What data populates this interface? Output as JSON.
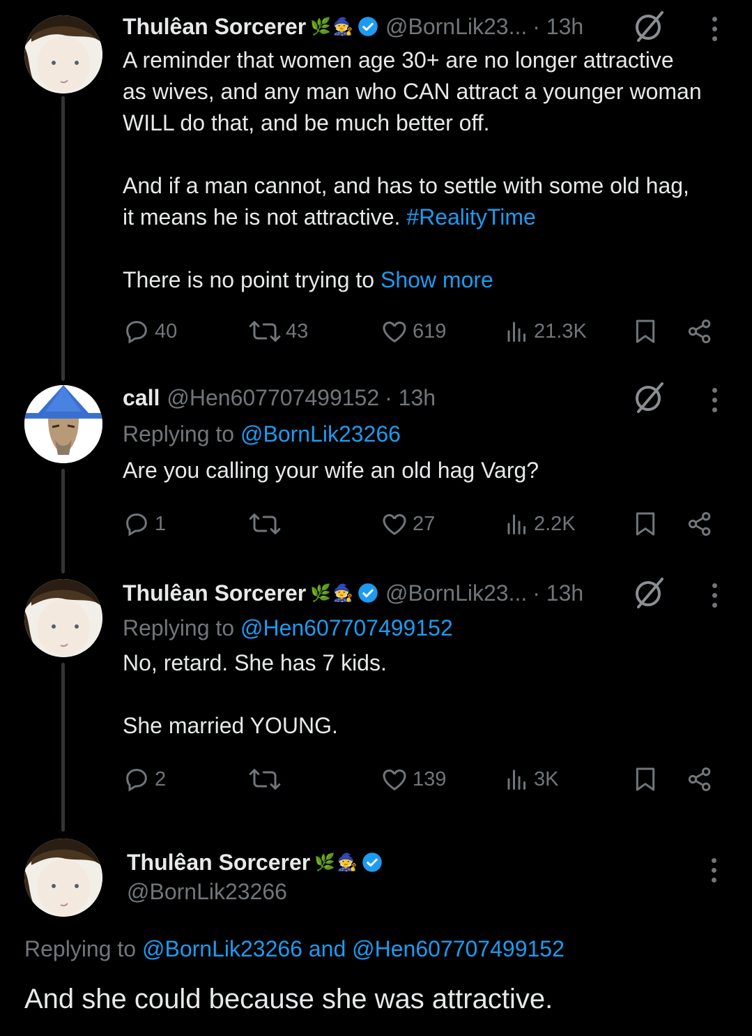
{
  "tweets": [
    {
      "name": "Thulêan Sorcerer",
      "handle": "@BornLik23...",
      "time": "· 13h",
      "body_lines": [
        "A reminder that women age 30+ are no longer attractive",
        "as wives, and any man who CAN attract a younger woman",
        "WILL do that, and be much better off."
      ],
      "body_para2_line1": "And if a man cannot, and has to settle with some old hag,",
      "body_para2_line2_text": "it means he is not attractive. ",
      "hashtag": "#RealityTime",
      "body_para3_text": "There is no point trying to ",
      "show_more": "Show more",
      "stats": {
        "replies": "40",
        "reposts": "43",
        "likes": "619",
        "views": "21.3K"
      }
    },
    {
      "name": "call",
      "handle": "@Hen607707499152",
      "time": "· 13h",
      "replying_prefix": "Replying to ",
      "replying_to": "@BornLik23266",
      "body": "Are you calling your wife an old hag Varg?",
      "stats": {
        "replies": "1",
        "reposts": "",
        "likes": "27",
        "views": "2.2K"
      }
    },
    {
      "name": "Thulêan Sorcerer",
      "handle": "@BornLik23...",
      "time": "· 13h",
      "replying_prefix": "Replying to ",
      "replying_to": "@Hen607707499152",
      "body_line1": "No, retard. She has 7 kids.",
      "body_line2": "She married YOUNG.",
      "stats": {
        "replies": "2",
        "reposts": "",
        "likes": "139",
        "views": "3K"
      }
    }
  ],
  "focused": {
    "name": "Thulêan Sorcerer",
    "handle": "@BornLik23266",
    "replying_prefix": "Replying to ",
    "replying_to": "@BornLik23266 and @Hen607707499152",
    "body": "And she could because she was attractive."
  },
  "icons": [
    "reply-icon",
    "repost-icon",
    "like-icon",
    "views-icon",
    "bookmark-icon",
    "share-icon",
    "grok-icon",
    "more-icon",
    "verified-icon"
  ],
  "colors": {
    "background": "#000000",
    "text": "#e7e9ea",
    "muted": "#71767b",
    "link": "#1d9bf0",
    "verified": "#1d9bf0"
  }
}
